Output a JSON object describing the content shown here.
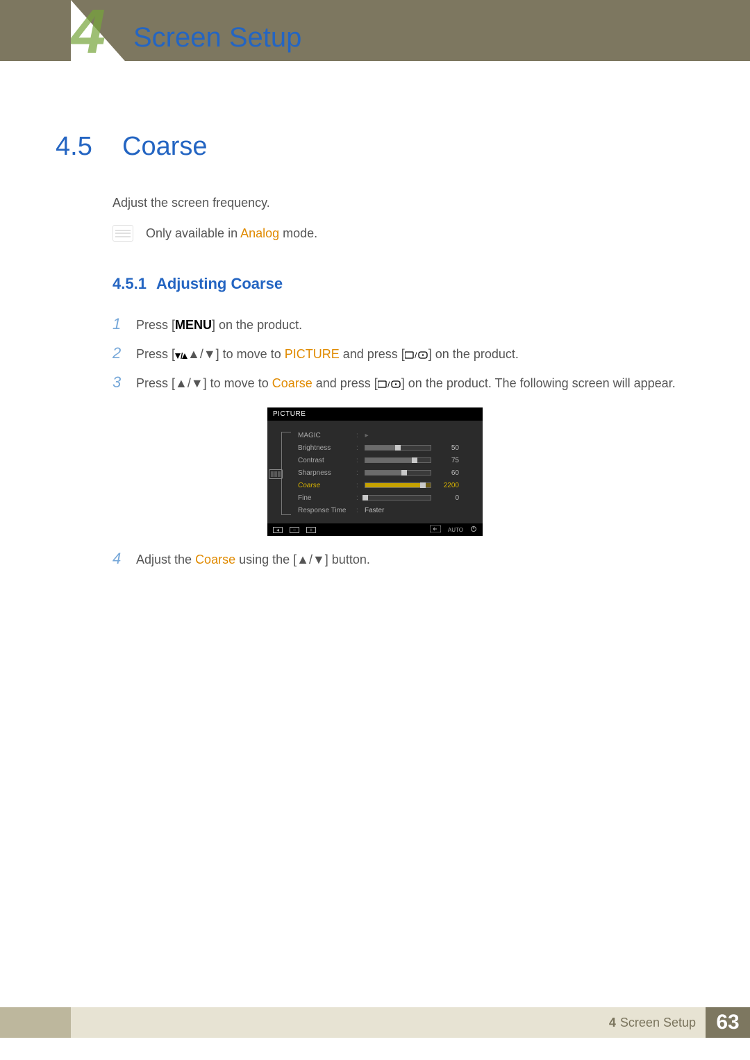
{
  "chapter_number": "4",
  "header_title": "Screen Setup",
  "section": {
    "number": "4.5",
    "title": "Coarse"
  },
  "intro": "Adjust the screen frequency.",
  "note": {
    "pre": "Only available in ",
    "kw": "Analog",
    "post": " mode."
  },
  "subsection": {
    "number": "4.5.1",
    "title": "Adjusting Coarse"
  },
  "steps": {
    "s1": {
      "pre": "Press [",
      "kw": "MENU",
      "post": "] on the product."
    },
    "s2": {
      "pre": "Press [",
      "mid1": "] to move to ",
      "kw": "PICTURE",
      "mid2": " and press [",
      "post": "] on the product."
    },
    "s3": {
      "pre": "Press [",
      "mid1": "] to move to ",
      "kw": "Coarse",
      "mid2": " and press [",
      "post": "] on the product. The following screen will appear."
    },
    "s4": {
      "pre": "Adjust the ",
      "kw": "Coarse",
      "mid": " using the [",
      "post": "] button."
    }
  },
  "osd": {
    "title": "PICTURE",
    "rows": [
      {
        "label": "MAGIC",
        "type": "submenu"
      },
      {
        "label": "Brightness",
        "type": "slider",
        "value": 50,
        "max": 100
      },
      {
        "label": "Contrast",
        "type": "slider",
        "value": 75,
        "max": 100
      },
      {
        "label": "Sharpness",
        "type": "slider",
        "value": 60,
        "max": 100
      },
      {
        "label": "Coarse",
        "type": "slider",
        "value": 2200,
        "max": 2500,
        "highlight": true
      },
      {
        "label": "Fine",
        "type": "slider",
        "value": 0,
        "max": 100
      },
      {
        "label": "Response Time",
        "type": "text",
        "text": "Faster"
      }
    ],
    "foot_auto": "AUTO"
  },
  "footer": {
    "chapter": "4",
    "title": "Screen Setup",
    "page": "63"
  }
}
